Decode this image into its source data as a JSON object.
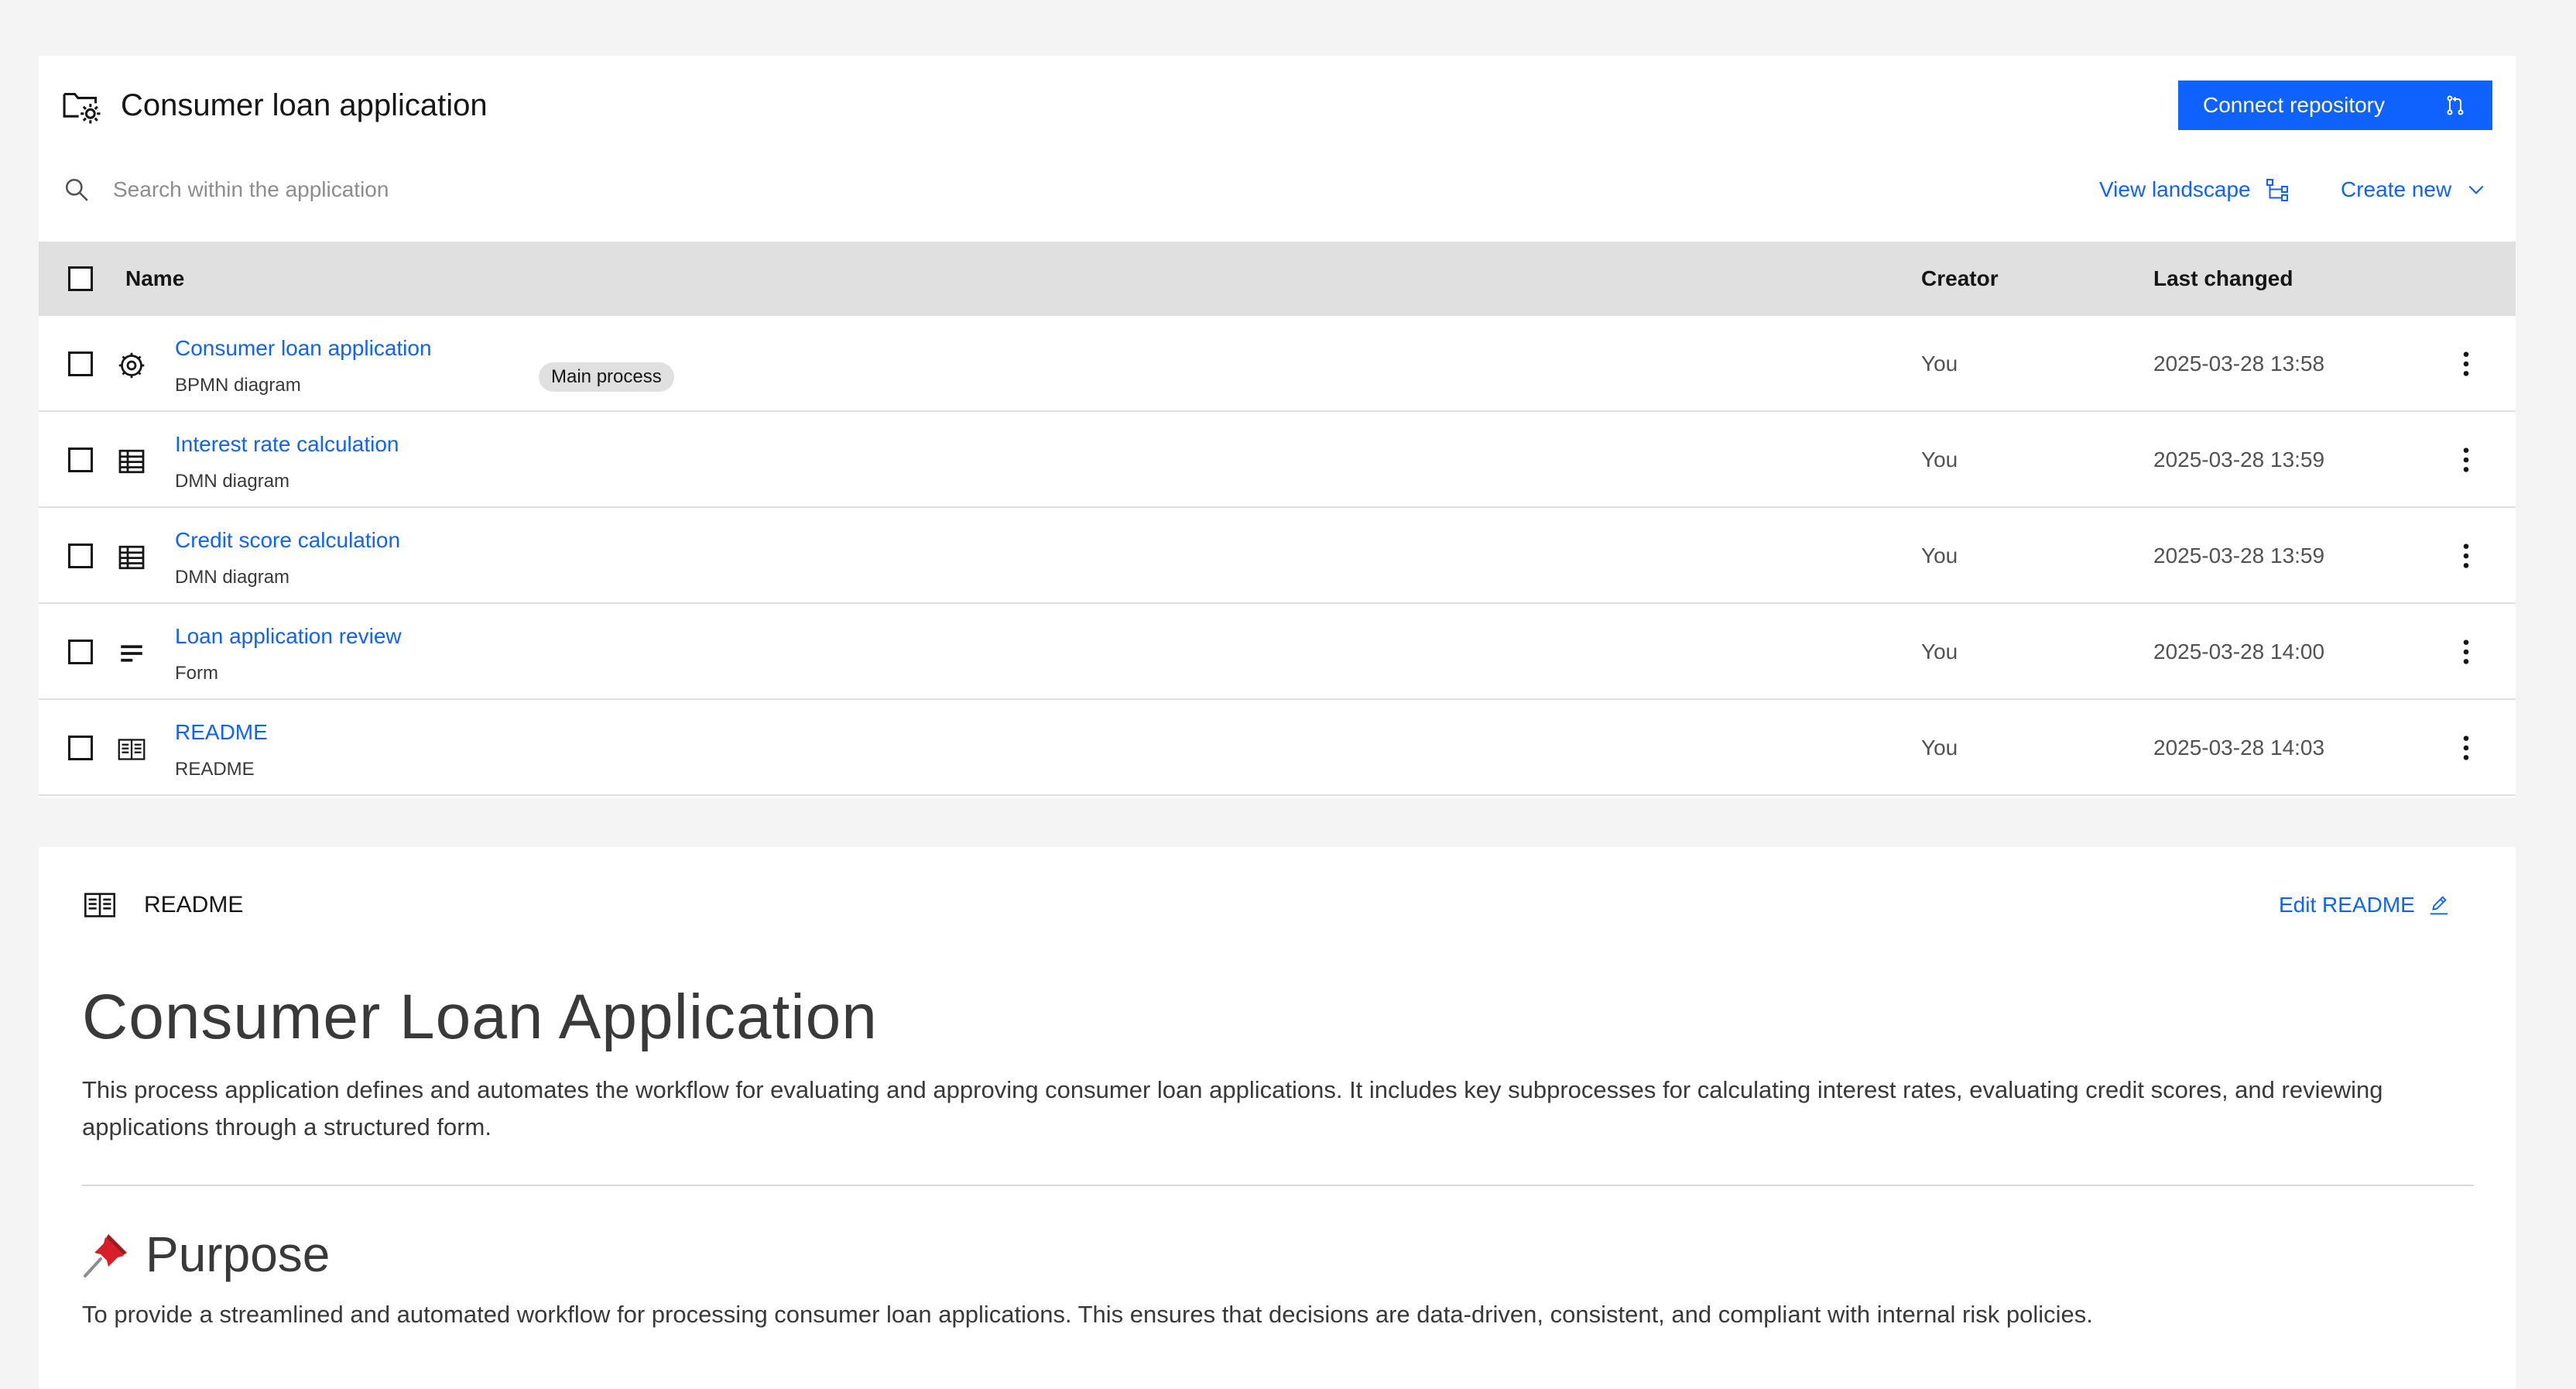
{
  "header": {
    "title": "Consumer loan application",
    "connect_label": "Connect repository"
  },
  "toolbar": {
    "search_placeholder": "Search within the application",
    "view_landscape_label": "View landscape",
    "create_new_label": "Create new"
  },
  "table": {
    "columns": {
      "name": "Name",
      "creator": "Creator",
      "last_changed": "Last changed"
    },
    "rows": [
      {
        "name": "Consumer loan application",
        "type": "BPMN diagram",
        "icon": "gear-icon",
        "tag": "Main process",
        "creator": "You",
        "last_changed": "2025-03-28 13:58"
      },
      {
        "name": "Interest rate calculation",
        "type": "DMN diagram",
        "icon": "table-icon",
        "tag": "",
        "creator": "You",
        "last_changed": "2025-03-28 13:59"
      },
      {
        "name": "Credit score calculation",
        "type": "DMN diagram",
        "icon": "table-icon",
        "tag": "",
        "creator": "You",
        "last_changed": "2025-03-28 13:59"
      },
      {
        "name": "Loan application review",
        "type": "Form",
        "icon": "form-icon",
        "tag": "",
        "creator": "You",
        "last_changed": "2025-03-28 14:00"
      },
      {
        "name": "README",
        "type": "README",
        "icon": "book-icon",
        "tag": "",
        "creator": "You",
        "last_changed": "2025-03-28 14:03"
      }
    ]
  },
  "readme": {
    "label": "README",
    "edit_label": "Edit README",
    "h1": "Consumer Loan Application",
    "intro": "This process application defines and automates the workflow for evaluating and approving consumer loan applications. It includes key subprocesses for calculating interest rates, evaluating credit scores, and reviewing applications through a structured form.",
    "purpose_heading": "Purpose",
    "purpose_text": "To provide a streamlined and automated workflow for processing consumer loan applications. This ensures that decisions are data-driven, consistent, and compliant with internal risk policies."
  },
  "colors": {
    "primary": "#0f62fe",
    "page_bg": "#f4f4f4",
    "header_row_bg": "#e0e0e0",
    "text": "#161616"
  }
}
